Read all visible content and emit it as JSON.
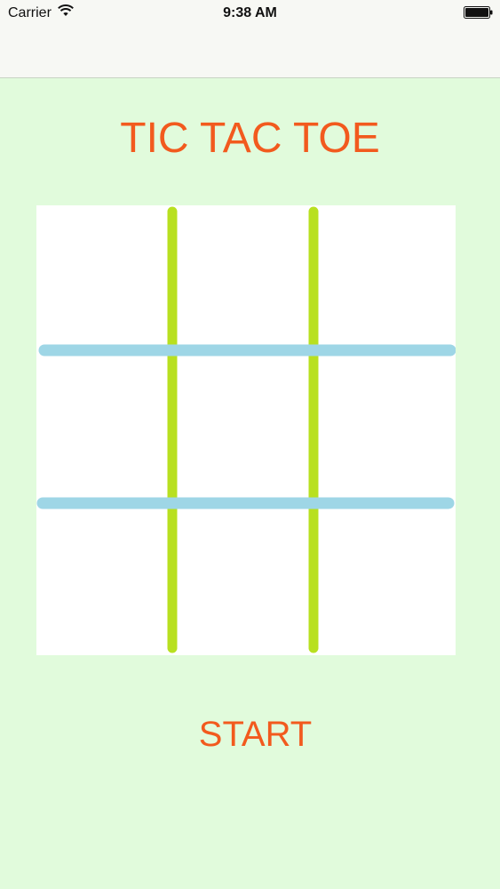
{
  "status_bar": {
    "carrier": "Carrier",
    "time": "9:38 AM",
    "wifi_icon": "wifi-icon",
    "battery_icon": "battery-icon"
  },
  "app": {
    "title": "TIC TAC TOE",
    "start_label": "START"
  },
  "board": {
    "rows": 3,
    "cols": 3,
    "cells": [
      "",
      "",
      "",
      "",
      "",
      "",
      "",
      "",
      ""
    ]
  },
  "colors": {
    "background": "#e1fbdc",
    "accent": "#f25a1e",
    "vertical_lines": "#b8e020",
    "horizontal_lines": "#9ed6e6",
    "board": "#ffffff"
  }
}
